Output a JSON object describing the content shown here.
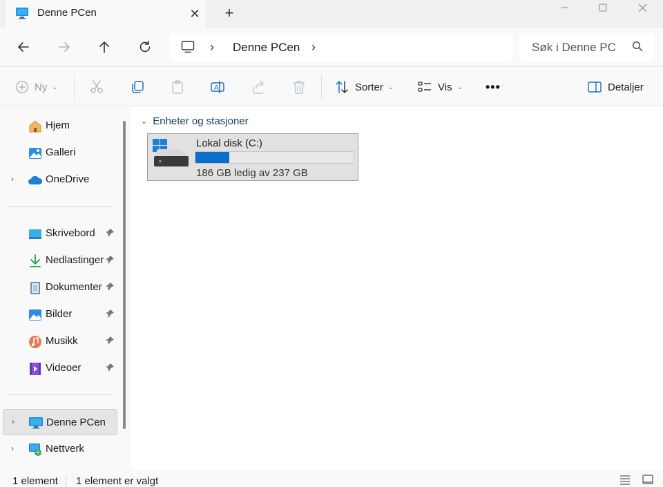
{
  "titlebar": {
    "tab_title": "Denne PCen",
    "tab_close": "✕",
    "new_tab": "+",
    "window_controls": [
      "minimize-icon",
      "maximize-icon",
      "close-icon"
    ]
  },
  "navbar": {
    "back": "arrow-left-icon",
    "forward": "arrow-right-icon",
    "up": "arrow-up-icon",
    "refresh": "refresh-icon",
    "breadcrumb": "Denne PCen",
    "search_placeholder": "Søk i Denne PCen"
  },
  "commandbar": {
    "new_label": "Ny",
    "sort_label": "Sorter",
    "view_label": "Vis",
    "more": "•••",
    "details_label": "Detaljer"
  },
  "sidebar": {
    "items": [
      {
        "label": "Hjem",
        "icon": "home-icon"
      },
      {
        "label": "Galleri",
        "icon": "gallery-icon"
      },
      {
        "label": "OneDrive",
        "icon": "cloud-icon",
        "expander": "›"
      },
      {
        "label": "Skrivebord",
        "icon": "desktop-icon",
        "pinned": true
      },
      {
        "label": "Nedlastinger",
        "icon": "download-icon",
        "pinned": true
      },
      {
        "label": "Dokumenter",
        "icon": "document-icon",
        "pinned": true
      },
      {
        "label": "Bilder",
        "icon": "pictures-icon",
        "pinned": true
      },
      {
        "label": "Musikk",
        "icon": "music-icon",
        "pinned": true
      },
      {
        "label": "Videoer",
        "icon": "video-icon",
        "pinned": true
      },
      {
        "label": "Denne PCen",
        "icon": "computer-icon",
        "expander": "›",
        "selected": true
      },
      {
        "label": "Nettverk",
        "icon": "network-icon",
        "expander": "›"
      }
    ]
  },
  "main": {
    "group_header": "Enheter og stasjoner",
    "group_chevron": "⌄",
    "drive": {
      "name": "Lokal disk (C:)",
      "free_text": "186 GB ledig av 237 GB",
      "used_fraction": 0.215
    }
  },
  "statusbar": {
    "count": "1 element",
    "selected": "1 element er valgt"
  },
  "colors": {
    "accent": "#0a6fc9",
    "folder_header": "#1a3b6e",
    "selection_bg": "#e5e5e5"
  }
}
